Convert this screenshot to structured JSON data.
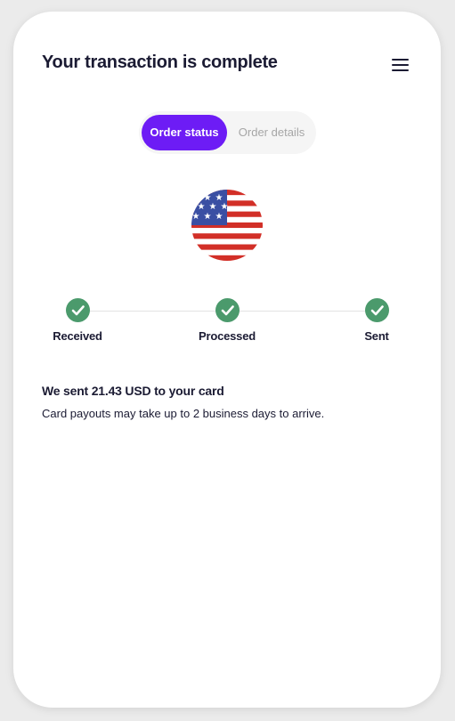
{
  "header": {
    "title": "Your transaction is complete",
    "menu_icon": "hamburger-menu-icon"
  },
  "tabs": [
    {
      "label": "Order status",
      "active": true
    },
    {
      "label": "Order details",
      "active": false
    }
  ],
  "currency_flag": {
    "icon": "us-flag-icon"
  },
  "progress": {
    "steps": [
      {
        "label": "Received",
        "status": "complete"
      },
      {
        "label": "Processed",
        "status": "complete"
      },
      {
        "label": "Sent",
        "status": "complete"
      }
    ]
  },
  "message": {
    "title": "We sent 21.43 USD to your card",
    "body": "Card payouts may take up to 2 business days to arrive."
  },
  "colors": {
    "accent": "#6d1cf5",
    "success": "#4b9a6c",
    "text": "#1b1b33",
    "muted": "#a6a6a6"
  }
}
